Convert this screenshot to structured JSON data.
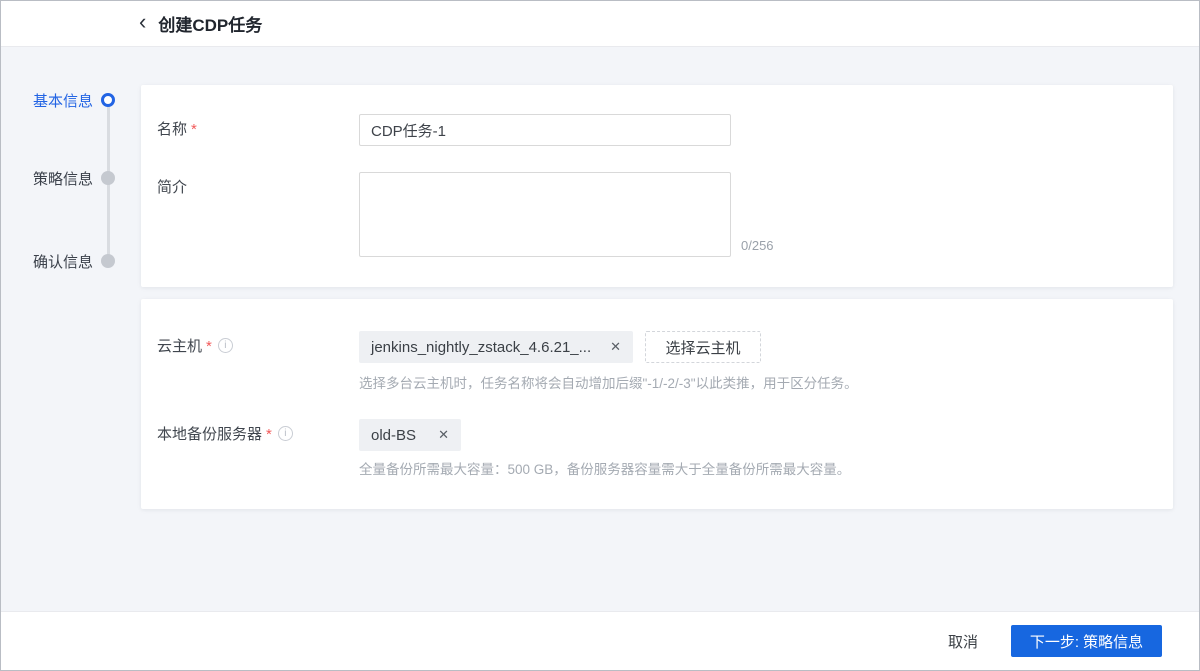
{
  "header": {
    "back_glyph": "‹",
    "title": "创建CDP任务"
  },
  "stepper": {
    "steps": [
      {
        "label": "基本信息",
        "state": "active"
      },
      {
        "label": "策略信息",
        "state": "pending"
      },
      {
        "label": "确认信息",
        "state": "pending"
      }
    ]
  },
  "form": {
    "required_mark": "*",
    "basic": {
      "name_label": "名称",
      "name_value": "CDP任务-1",
      "desc_label": "简介",
      "desc_value": "",
      "desc_counter": "0/256"
    },
    "vm": {
      "label": "云主机",
      "tag": "jenkins_nightly_zstack_4.6.21_...",
      "select_button": "选择云主机",
      "hint": "选择多台云主机时，任务名称将会自动增加后缀\"-1/-2/-3\"以此类推，用于区分任务。"
    },
    "bs": {
      "label": "本地备份服务器",
      "tag": "old-BS",
      "hint": "全量备份所需最大容量：500 GB，备份服务器容量需大于全量备份所需最大容量。"
    }
  },
  "icons": {
    "info_glyph": "i",
    "close_glyph": "✕"
  },
  "footer": {
    "cancel_label": "取消",
    "next_label": "下一步: 策略信息"
  },
  "colors": {
    "accent": "#1767e0",
    "step_active": "#2264e4",
    "required": "#f25a5a"
  }
}
